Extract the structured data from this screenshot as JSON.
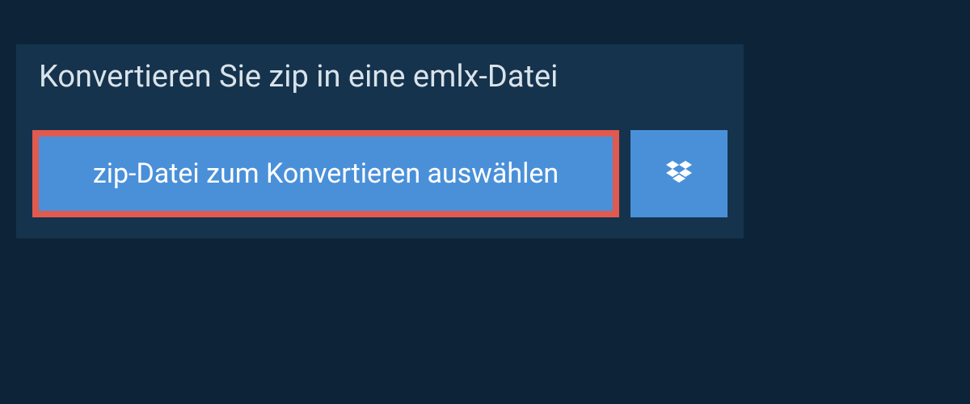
{
  "header": {
    "title": "Konvertieren Sie zip in eine emlx-Datei"
  },
  "actions": {
    "select_file_label": "zip-Datei zum Konvertieren auswählen",
    "dropbox_label": "Dropbox"
  },
  "colors": {
    "background": "#0d2438",
    "panel": "#15334d",
    "button": "#4a90d9",
    "highlight_border": "#e05a4f",
    "text_light": "#d9e3ea",
    "text_white": "#ffffff"
  }
}
